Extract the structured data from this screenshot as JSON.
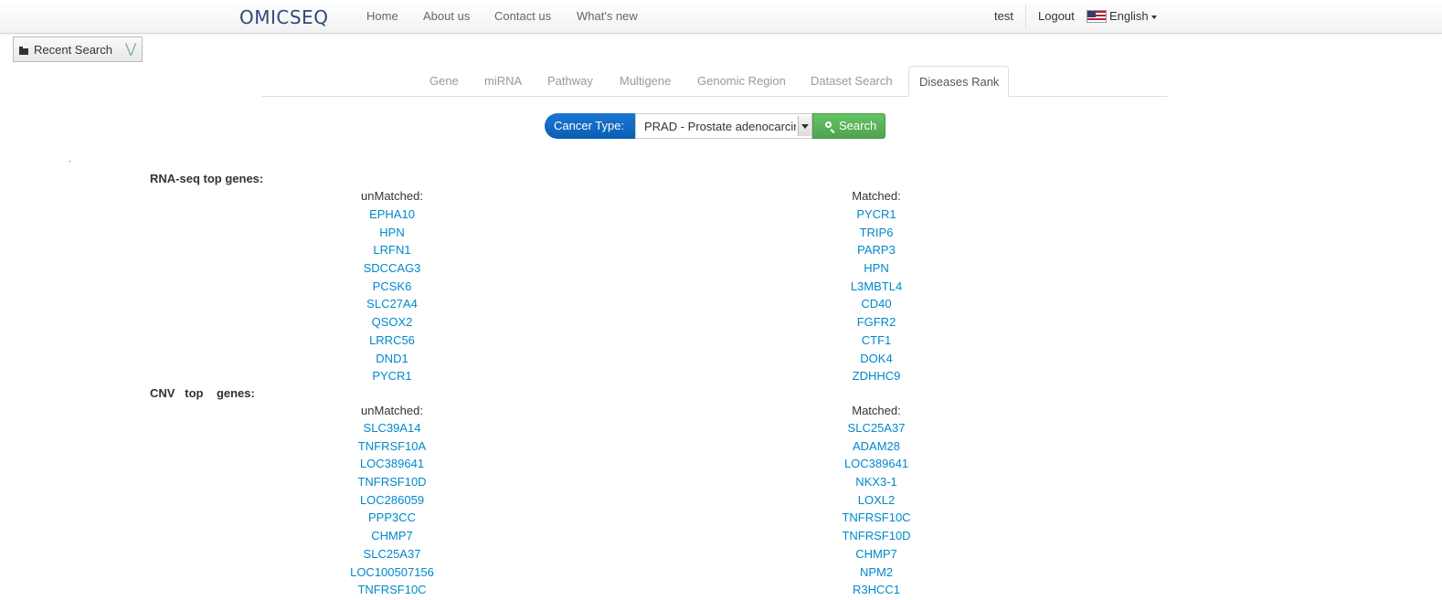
{
  "nav": {
    "brand": "OMICSEQ",
    "links": [
      "Home",
      "About us",
      "Contact us",
      "What's new"
    ],
    "user": "test",
    "logout": "Logout",
    "language": "English"
  },
  "recent_search": {
    "label": "Recent Search"
  },
  "tabs": [
    "Gene",
    "miRNA",
    "Pathway",
    "Multigene",
    "Genomic Region",
    "Dataset Search",
    "Diseases Rank"
  ],
  "active_tab": "Diseases Rank",
  "search": {
    "cancer_type_label": "Cancer Type:",
    "selected": "PRAD - Prostate adenocarcinoma",
    "button": "Search"
  },
  "rna": {
    "title": "RNA-seq top genes:",
    "unmatched_label": "unMatched:",
    "matched_label": "Matched:",
    "unmatched": [
      "EPHA10",
      "HPN",
      "LRFN1",
      "SDCCAG3",
      "PCSK6",
      "SLC27A4",
      "QSOX2",
      "LRRC56",
      "DND1",
      "PYCR1"
    ],
    "matched": [
      "PYCR1",
      "TRIP6",
      "PARP3",
      "HPN",
      "L3MBTL4",
      "CD40",
      "FGFR2",
      "CTF1",
      "DOK4",
      "ZDHHC9"
    ]
  },
  "cnv": {
    "title": "CNV   top    genes:",
    "unmatched_label": "unMatched:",
    "matched_label": "Matched:",
    "unmatched": [
      "SLC39A14",
      "TNFRSF10A",
      "LOC389641",
      "TNFRSF10D",
      "LOC286059",
      "PPP3CC",
      "CHMP7",
      "SLC25A37",
      "LOC100507156",
      "TNFRSF10C"
    ],
    "matched": [
      "SLC25A37",
      "ADAM28",
      "LOC389641",
      "NKX3-1",
      "LOXL2",
      "TNFRSF10C",
      "TNFRSF10D",
      "CHMP7",
      "NPM2",
      "R3HCC1"
    ]
  },
  "colors": {
    "link": "#0088cc",
    "brand": "#2e4a7a",
    "cancer_type_bg": "#1a76d2",
    "search_btn": "#5cb85c"
  }
}
